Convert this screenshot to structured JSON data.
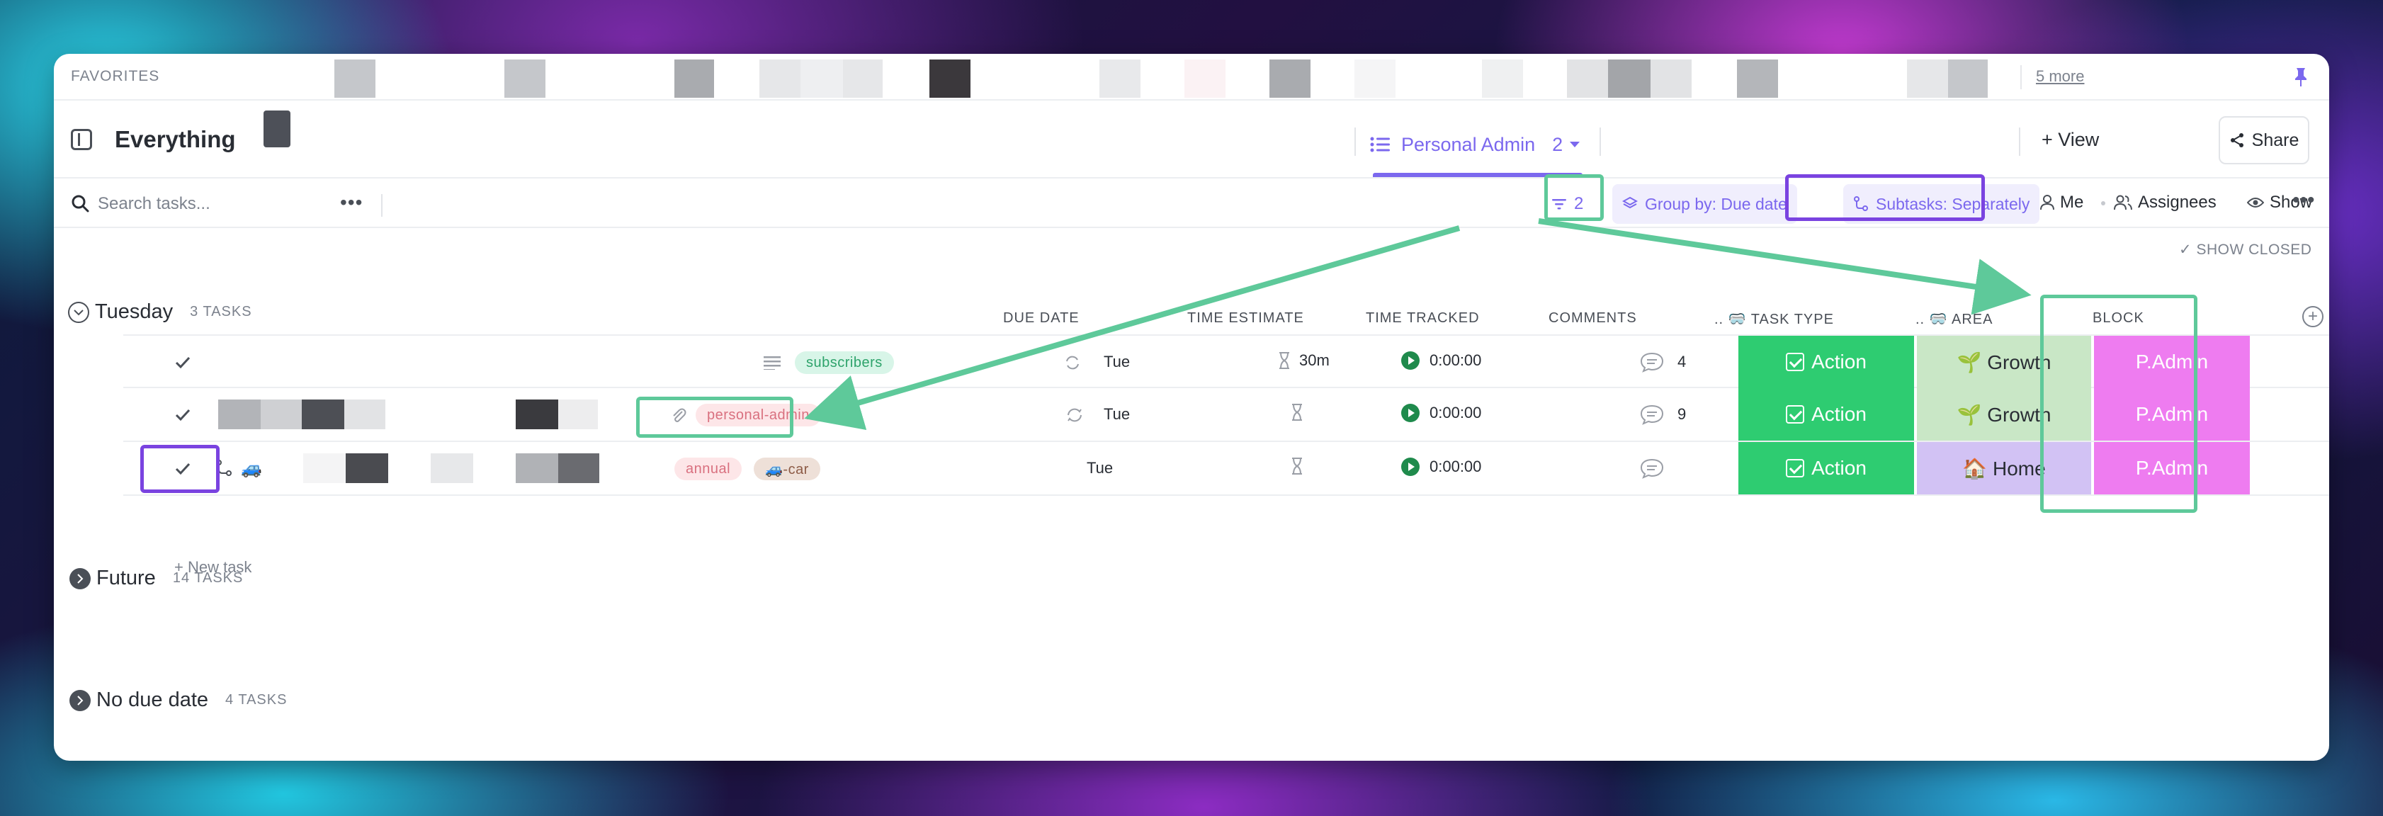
{
  "favorites": {
    "label": "FAVORITES",
    "more": "5 more"
  },
  "header": {
    "title": "Everything",
    "view_name": "Personal Admin",
    "view_count": "2",
    "add_view": "+ View",
    "share": "Share"
  },
  "toolbar": {
    "search_placeholder": "Search tasks...",
    "filter_count": "2",
    "group_by_label": "Group by:",
    "group_by_value": "Due date",
    "subtasks": "Subtasks: Separately",
    "me": "Me",
    "assignees": "Assignees",
    "show": "Show",
    "show_closed": "SHOW CLOSED"
  },
  "columns": {
    "due_date": "DUE DATE",
    "time_estimate": "TIME ESTIMATE",
    "time_tracked": "TIME TRACKED",
    "comments": "COMMENTS",
    "task_type": ".. 🥽 TASK TYPE",
    "area": ".. 🥽 AREA",
    "block": "BLOCK"
  },
  "groups": [
    {
      "name": "Tuesday",
      "count": "3 TASKS",
      "expanded": true
    },
    {
      "name": "Future",
      "count": "14 TASKS",
      "expanded": false
    },
    {
      "name": "No due date",
      "count": "4 TASKS",
      "expanded": false
    }
  ],
  "tasks": [
    {
      "tags": [
        "subscribers"
      ],
      "due": "Tue",
      "estimate": "30m",
      "tracked": "0:00:00",
      "comments": "4",
      "task_type": "Action",
      "area": "🌱 Growth",
      "block": "P.Admin"
    },
    {
      "tags": [
        "personal-admin"
      ],
      "due": "Tue",
      "estimate": "",
      "tracked": "0:00:00",
      "comments": "9",
      "task_type": "Action",
      "area": "🌱 Growth",
      "block": "P.Admin"
    },
    {
      "tags": [
        "annual",
        "🚙-car"
      ],
      "subtask_icon": "🚙",
      "due": "Tue",
      "estimate": "",
      "tracked": "0:00:00",
      "comments": "",
      "task_type": "Action",
      "area": "🏠 Home",
      "block": "P.Admin"
    }
  ],
  "new_task": "+ New task",
  "colors": {
    "accent": "#7b68ee",
    "action": "#2ecc71",
    "growth": "#c9e7c6",
    "home": "#d2c2f4",
    "block": "#ee7cf0",
    "annotation_green": "#5ec99a",
    "annotation_purple": "#7a43e0"
  }
}
